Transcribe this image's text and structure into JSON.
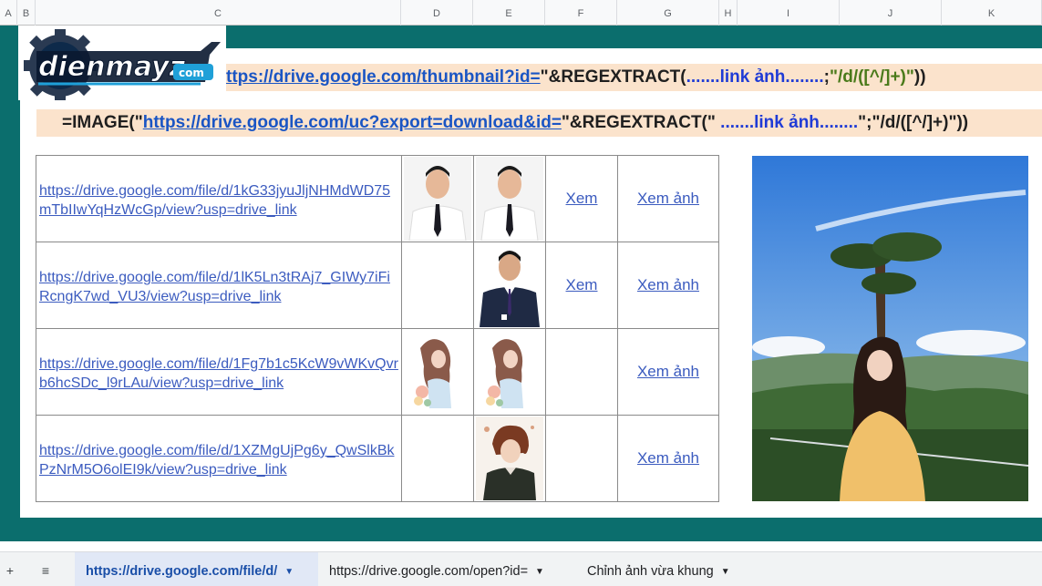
{
  "columns": [
    "A",
    "B",
    "C",
    "D",
    "E",
    "F",
    "G",
    "H",
    "I",
    "J",
    "K"
  ],
  "logo": {
    "text": "dienmayz",
    "suffix": "com"
  },
  "formula1": {
    "prefix": "ttps://drive.google.com/thumbnail?id=",
    "quote_close": "\"",
    "mid": "&REGEXTRACT(",
    "dots": ".......link ảnh........",
    "semicolon": ";",
    "regex": "\"/d/([^/]+)\"",
    "tail": "))"
  },
  "formula2": {
    "head": "=IMAGE(\"",
    "url": "https://drive.google.com/uc?export=download&id=",
    "mid": "\"&REGEXTRACT(\" ",
    "dots": ".......link ảnh........",
    "tail": "\";\"/d/([^/]+)\"))"
  },
  "rows": [
    {
      "url": "https://drive.google.com/file/d/1kG33jyuJljNHMdWD75mTbIIwYqHzWcGp/view?usp=drive_link",
      "xem": "Xem",
      "xem_anh": "Xem ảnh"
    },
    {
      "url": "https://drive.google.com/file/d/1lK5Ln3tRAj7_GIWy7iFiRcngK7wd_VU3/view?usp=drive_link",
      "xem": "Xem",
      "xem_anh": "Xem ảnh"
    },
    {
      "url": "https://drive.google.com/file/d/1Fg7b1c5KcW9vWKvQvrb6hcSDc_l9rLAu/view?usp=drive_link",
      "xem": "",
      "xem_anh": "Xem ảnh"
    },
    {
      "url": "https://drive.google.com/file/d/1XZMgUjPg6y_QwSlkBkPzNrM5O6olEI9k/view?usp=drive_link",
      "xem": "",
      "xem_anh": "Xem ảnh"
    }
  ],
  "tabs": {
    "add": "+",
    "menu": "≡",
    "items": [
      {
        "label": "https://drive.google.com/file/d/",
        "active": true
      },
      {
        "label": "https://drive.google.com/open?id=",
        "active": false
      },
      {
        "label": "Chỉnh ảnh vừa khung",
        "active": false
      }
    ]
  },
  "colors": {
    "teal": "#0b6e6d",
    "band": "#fbe3cc",
    "link": "#3b5bbf"
  }
}
